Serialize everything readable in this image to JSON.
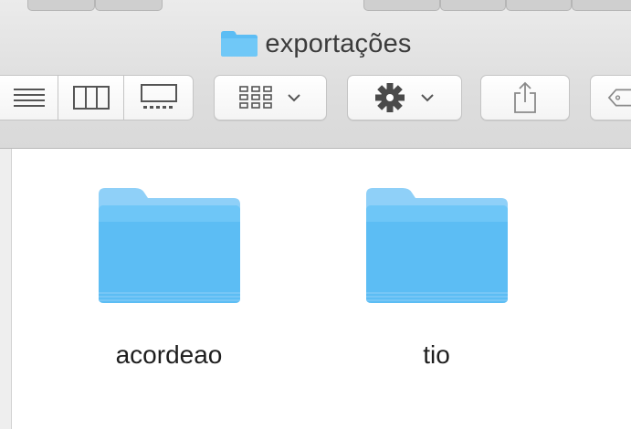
{
  "window": {
    "title": "exportações",
    "title_icon": "folder-icon"
  },
  "toolbar": {
    "view_buttons": [
      {
        "name": "list-view-button",
        "icon": "list-view-icon"
      },
      {
        "name": "column-view-button",
        "icon": "column-view-icon"
      },
      {
        "name": "gallery-view-button",
        "icon": "gallery-view-icon"
      }
    ],
    "arrange_button": {
      "icon": "arrange-grid-icon",
      "menu_icon": "chevron-down-icon"
    },
    "action_button": {
      "icon": "gear-icon",
      "menu_icon": "chevron-down-icon"
    },
    "share_button": {
      "icon": "share-icon"
    },
    "tags_button": {
      "icon": "tag-icon"
    }
  },
  "items": [
    {
      "label": "acordeao",
      "type": "folder"
    },
    {
      "label": "tio",
      "type": "folder"
    }
  ],
  "colors": {
    "folder_top": "#8fd0f8",
    "folder_body": "#5cbdf4",
    "title_text": "#3b3b3b",
    "toolbar_bg": "#dedede"
  }
}
